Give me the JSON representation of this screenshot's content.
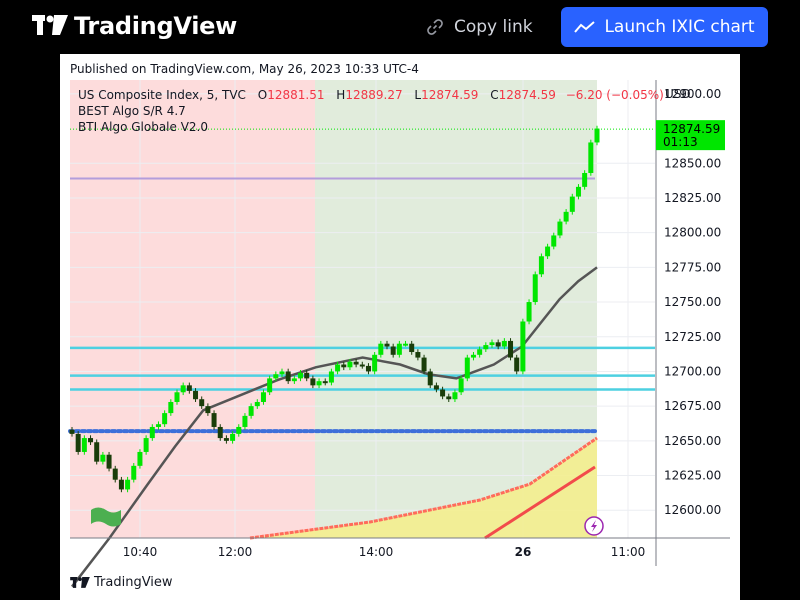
{
  "header": {
    "brand": "TradingView",
    "copy_link_label": "Copy link",
    "launch_label": "Launch IXIC chart"
  },
  "card": {
    "published": "Published on TradingView.com, May 26, 2023 10:33 UTC-4",
    "footer_brand": "TradingView"
  },
  "legend": {
    "symbol": "US Composite Index, 5, TVC",
    "open_label": "O",
    "open": "12881.51",
    "high_label": "H",
    "high": "12889.27",
    "low_label": "L",
    "low": "12874.59",
    "close_label": "C",
    "close": "12874.59",
    "change": "−6.20 (−0.05%)",
    "indicator_1": "BEST Algo S/R 4.7",
    "indicator_2": "BTI Algo Globale V2.0"
  },
  "colors": {
    "up": "#00e600",
    "down": "#1a3d0a",
    "bg_bear_zone": "#fddcdc",
    "bg_bull_zone": "#e1ecdc",
    "sr_line": "#4dd0e1",
    "purple_line": "#b39ddb",
    "dotted_line": "#3d6fd9",
    "ma_line": "#555555",
    "accent": "#2962ff"
  },
  "chart_data": {
    "type": "line",
    "title": "",
    "price_scale_label": "USD",
    "y_ticks": [
      "12900.00",
      "12850.00",
      "12825.00",
      "12800.00",
      "12775.00",
      "12750.00",
      "12725.00",
      "12700.00",
      "12675.00",
      "12650.00",
      "12625.00",
      "12600.00"
    ],
    "ylim": [
      12580,
      12910
    ],
    "x_ticks": [
      "10:40",
      "12:00",
      "14:00",
      "26",
      "11:00"
    ],
    "x_ticks_bold": [
      "26"
    ],
    "last_price_label": "12874.59",
    "countdown": "01:13",
    "grid": true,
    "candles_close": [
      12655,
      12642,
      12652,
      12649,
      12635,
      12640,
      12630,
      12622,
      12615,
      12622,
      12632,
      12642,
      12652,
      12660,
      12662,
      12670,
      12678,
      12685,
      12690,
      12686,
      12680,
      12675,
      12670,
      12660,
      12652,
      12650,
      12655,
      12660,
      12668,
      12675,
      12678,
      12685,
      12695,
      12698,
      12700,
      12693,
      12695,
      12699,
      12695,
      12690,
      12693,
      12692,
      12700,
      12705,
      12703,
      12707,
      12705,
      12704,
      12700,
      12712,
      12720,
      12718,
      12712,
      12720,
      12720,
      12714,
      12710,
      12700,
      12690,
      12687,
      12682,
      12680,
      12685,
      12695,
      12710,
      12712,
      12716,
      12719,
      12721,
      12718,
      12722,
      12710,
      12700,
      12736,
      12750,
      12770,
      12783,
      12790,
      12798,
      12808,
      12815,
      12826,
      12833,
      12843,
      12865,
      12875
    ],
    "moving_average": [
      [
        0,
        12545
      ],
      [
        20,
        12580
      ],
      [
        40,
        12618
      ],
      [
        55,
        12646
      ],
      [
        70,
        12672
      ],
      [
        90,
        12683
      ],
      [
        110,
        12694
      ],
      [
        130,
        12703
      ],
      [
        155,
        12710
      ],
      [
        175,
        12705
      ],
      [
        190,
        12698
      ],
      [
        205,
        12695
      ],
      [
        215,
        12700
      ],
      [
        225,
        12705
      ],
      [
        240,
        12718
      ],
      [
        250,
        12735
      ],
      [
        260,
        12752
      ],
      [
        270,
        12765
      ],
      [
        280,
        12775
      ]
    ],
    "support_resistance": [
      12717,
      12697,
      12687
    ],
    "purple_level": 12839,
    "dotted_level": 12657,
    "sessions": [
      "bear-zone",
      "bull-zone"
    ]
  }
}
